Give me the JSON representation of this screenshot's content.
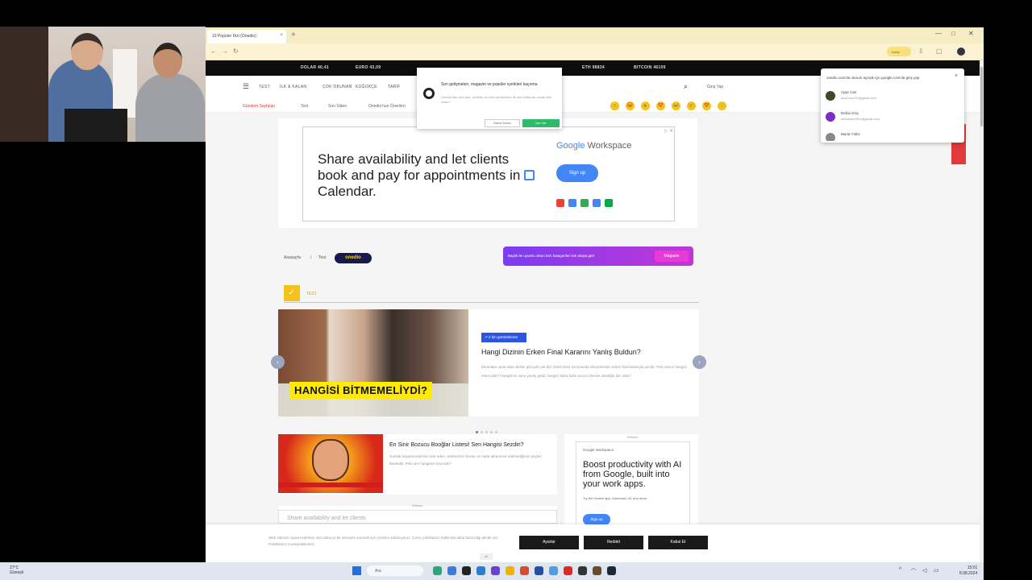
{
  "browser": {
    "tab_title": "10 Popüler Dizi (Onedio)",
    "tab_close": "×",
    "new_tab": "+",
    "window_controls": [
      "—",
      "□",
      "✕"
    ],
    "install_label": "Instal",
    "address_icons": [
      "←",
      "→",
      "↻"
    ]
  },
  "site": {
    "topbar": [
      "DOLAR 40,41",
      "EURO 43,09",
      "ETH 98834",
      "BITCOIN 46109"
    ],
    "nav": [
      "TEST",
      "İLK & KALAN",
      "ÇOK OKUNAN",
      "KÜĞÜKÇE",
      "TARİF"
    ],
    "login": "Giriş Yap",
    "subnav": [
      {
        "label": "Gündem Sayfaları",
        "red": true
      },
      {
        "label": "Test",
        "red": false
      },
      {
        "label": "Son Video",
        "red": false
      },
      {
        "label": "Onedio'nun Önerileri",
        "red": false
      }
    ],
    "emojis": [
      "😐",
      "😡",
      "😮",
      "😍",
      "😂",
      "😢",
      "😍",
      "🙂",
      "😂"
    ]
  },
  "notification_popup": {
    "title": "Son gelişmeleri, magazin ve popüler içerikleri kaçırma",
    "subtitle": "Onedio'dan yeni test, içerikler ve özel içeriklerden ilk sen haberdar olmak ister misin?",
    "later": "Daha Sonra",
    "allow": "İzin Ver"
  },
  "google_popup": {
    "heading": "onedio.com'da oturum açmak için google.com'da giriş yap",
    "close": "×",
    "accounts": [
      {
        "name": "Ayşe Can",
        "email": "aysecan123@gmail.com",
        "color": "#3a4a2a"
      },
      {
        "name": "Defne Kılıç",
        "email": "defnekilic2000@gmail.com",
        "color": "#7a2fc2"
      },
      {
        "name": "Murat Yıldız",
        "email": "",
        "color": "#888888"
      }
    ]
  },
  "ad_banner": {
    "text_before": "Share availability and let clients book and pay for appointments in",
    "text_after": "Calendar.",
    "brand_g": "Google",
    "brand_rest": " Workspace",
    "signup": "Sign up",
    "ad_tag": "▷ ✕"
  },
  "breadcrumb": {
    "home": "Anasayfa",
    "sep": "/",
    "section": "Test",
    "pill": "onedio"
  },
  "promo": {
    "text": "Başlık ile uyumlu olsun tüm kategorileri tek akışta gör!",
    "button": "Magazin"
  },
  "category": {
    "icon": "✓",
    "label": "TEST"
  },
  "featured": {
    "caption": "HANGİSİ BİTMEMELİYDİ?",
    "badge": "↗ 2 bin görüntüleme",
    "title": "Hangi Dizinin Erken Final Kararını Yanlış Buldun?",
    "desc": "Ekranlara veda eden diziler gibi pek çok dizi 2023-2024 sezonunda izleyicilerden erken final kararıyla ayrıldı. Peki sence hangisi erken bitti? Hangisinin sonu yanlış geldi, hangisi daha fazla sezon izlemek istediğin dizi oldu?",
    "prev": "‹",
    "next": "›",
    "dots": 5,
    "active_dot": 0
  },
  "article2": {
    "title": "En Sinir Bozucu Booğlar Listesi! Sen Hangisi Sezdin?",
    "desc": "Günlük hayatımızda bizi sinir eden, sinirlerimizi bozan ve hatta tahammül edemediğimiz şeyleri listeledik. Peki sen hangisini seçerdin?"
  },
  "side_ad": {
    "label": "Reklam",
    "brand": "Google Workspace",
    "headline": "Boost productivity with AI from Google, built into your work apps.",
    "sub": "Try the Gemini app, Notebook LM, and more",
    "button": "Sign up"
  },
  "ad3": {
    "label": "Reklam",
    "text": "Share availability and let clients"
  },
  "cookie": {
    "text": "Web sitemizi ziyaret ederken size daha iyi bir deneyim sunmak için çerezler kullanıyoruz. Çerez politikamız hakkında daha fazla bilgi almak için Politikamızı inceleyebilirsiniz.",
    "buttons": [
      "Ayarlar",
      "Reddet",
      "Kabul Et"
    ],
    "close": "ok"
  },
  "taskbar": {
    "weather_temp": "27°C",
    "weather_desc": "Güneşli",
    "search": "Ara",
    "time": "15:01",
    "date": "8.08.2024"
  }
}
